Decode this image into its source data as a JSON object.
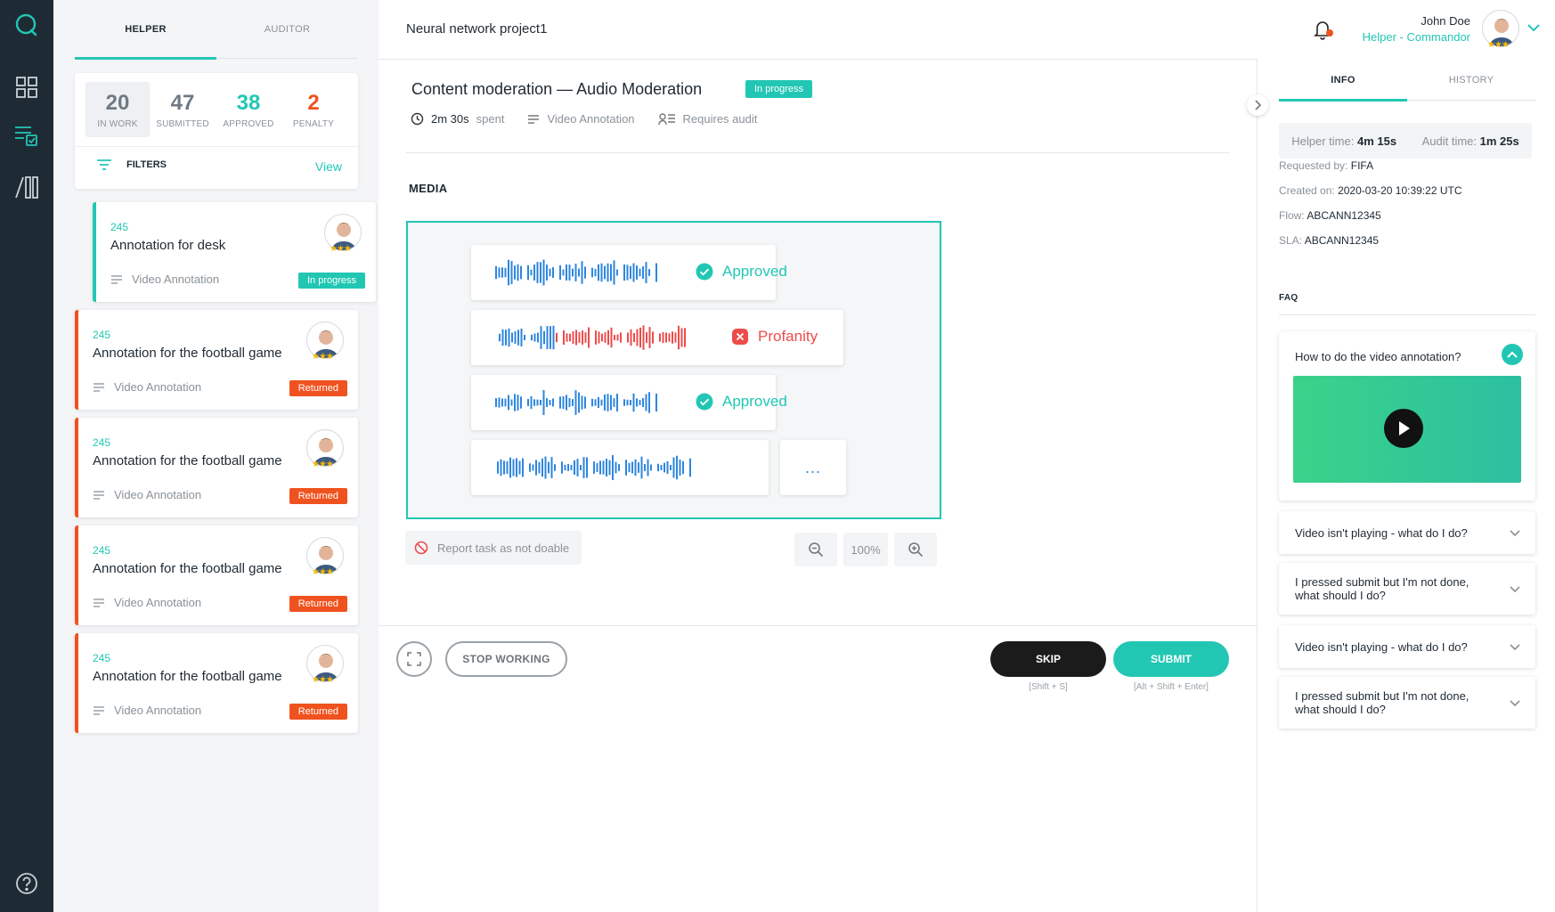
{
  "left_tabs": [
    "HELPER",
    "AUDITOR"
  ],
  "stats": [
    {
      "value": "20",
      "label": "IN WORK",
      "color": "#6f7a84"
    },
    {
      "value": "47",
      "label": "SUBMITTED",
      "color": "#6f7a84"
    },
    {
      "value": "38",
      "label": "APPROVED",
      "color": "#22c7b4"
    },
    {
      "value": "2",
      "label": "PENALTY",
      "color": "#f0521f"
    }
  ],
  "filters": {
    "label": "FILTERS",
    "view": "View"
  },
  "tasks": [
    {
      "num": "245",
      "title": "Annotation for desk",
      "type": "Video Annotation",
      "status": "In progress",
      "rating": "★★★"
    },
    {
      "num": "245",
      "title": "Annotation for the football game",
      "type": "Video Annotation",
      "status": "Returned",
      "rating": "★★★"
    },
    {
      "num": "245",
      "title": "Annotation for the football game",
      "type": "Video Annotation",
      "status": "Returned",
      "rating": "★★★"
    },
    {
      "num": "245",
      "title": "Annotation for the football game",
      "type": "Video Annotation",
      "status": "Returned",
      "rating": "★★★"
    },
    {
      "num": "245",
      "title": "Annotation for the football game",
      "type": "Video Annotation",
      "status": "Returned",
      "rating": "★★★"
    }
  ],
  "header": {
    "project": "Neural network project1"
  },
  "user": {
    "name": "John Doe",
    "role": "Helper - Commandor",
    "rating": "★★★"
  },
  "task": {
    "title": "Content moderation — Audio Moderation",
    "status": "In progress",
    "time_value": "2m 30s",
    "time_suffix": "spent",
    "type": "Video Annotation",
    "audit": "Requires audit"
  },
  "media": {
    "label": "MEDIA",
    "clips": [
      {
        "status": "Approved"
      },
      {
        "status": "Profanity"
      },
      {
        "status": "Approved"
      }
    ],
    "more": "..."
  },
  "report": "Report task as not doable",
  "zoom": "100%",
  "footer": {
    "stop": "STOP WORKING",
    "skip": "SKIP",
    "skip_hint": "[Shift + S]",
    "submit": "SUBMIT",
    "submit_hint": "[Alt + Shift + Enter]"
  },
  "right_tabs": [
    "INFO",
    "HISTORY"
  ],
  "times": {
    "helper_label": "Helper time:",
    "helper_value": "4m 15s",
    "audit_label": "Audit time:",
    "audit_value": "1m 25s"
  },
  "info": [
    {
      "label": "Requested by:",
      "value": "FIFA"
    },
    {
      "label": "Created on:",
      "value": "2020-03-20 10:39:22 UTC"
    },
    {
      "label": "Flow:",
      "value": "ABCANN12345"
    },
    {
      "label": "SLA:",
      "value": "ABCANN12345"
    }
  ],
  "faq": {
    "label": "FAQ",
    "open_question": "How to do the video annotation?",
    "items": [
      "Video isn't playing - what do I do?",
      "I pressed submit but I'm not done, what should I do?",
      "Video isn't playing - what do I do?",
      "I pressed submit but I'm not done, what should I do?"
    ]
  },
  "colors": {
    "accent": "#22c7b4",
    "danger": "#f0521f",
    "sidebar": "#1e2b34",
    "wave_blue": "#2e86de",
    "wave_red": "#ee4b4b"
  }
}
